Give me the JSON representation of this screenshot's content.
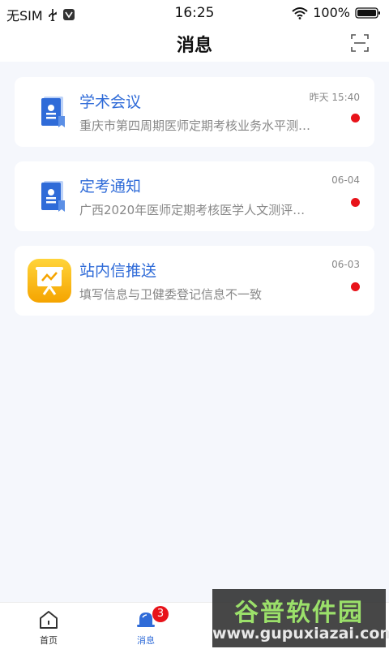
{
  "status_bar": {
    "carrier": "无SIM",
    "time": "16:25",
    "battery": "100%"
  },
  "header": {
    "title": "消息",
    "scan_icon": "scan-icon"
  },
  "messages": [
    {
      "title": "学术会议",
      "summary": "重庆市第四周期医师定期考核业务水平测…",
      "time": "昨天 15:40",
      "icon": "document-icon",
      "unread": true
    },
    {
      "title": "定考通知",
      "summary": "广西2020年医师定期考核医学人文测评…",
      "time": "06-04",
      "icon": "document-icon",
      "unread": true
    },
    {
      "title": "站内信推送",
      "summary": "填写信息与卫健委登记信息不一致",
      "time": "06-03",
      "icon": "presentation-icon",
      "unread": true
    }
  ],
  "tabs": [
    {
      "label": "首页",
      "icon": "home-icon",
      "active": false
    },
    {
      "label": "消息",
      "icon": "bell-icon",
      "active": true,
      "badge": "3"
    }
  ],
  "watermark": {
    "title": "谷普软件园",
    "url": "www.gupuxiazai.com"
  },
  "colors": {
    "accent": "#2f6bd8",
    "unread": "#e8131a",
    "background": "#f5f7fc"
  }
}
